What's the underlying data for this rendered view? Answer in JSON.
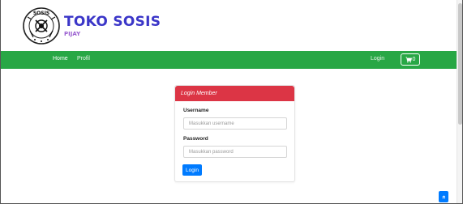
{
  "brand": {
    "title": "TOKO SOSIS",
    "subtitle": "PIJAY",
    "logo_text": "SOSIS"
  },
  "nav": {
    "home": "Home",
    "profil": "Profil",
    "login": "Login",
    "cart_count": "0",
    "bar_color": "#28a745"
  },
  "login_card": {
    "title": "Login Member",
    "username_label": "Username",
    "username_placeholder": "Masukkan username",
    "password_label": "Password",
    "password_placeholder": "Masukkan password",
    "button": "Login",
    "header_color": "#dc3545",
    "button_color": "#007bff"
  },
  "scroll_top": {
    "icon": "double-chevron-up-icon",
    "glyph": "»"
  }
}
